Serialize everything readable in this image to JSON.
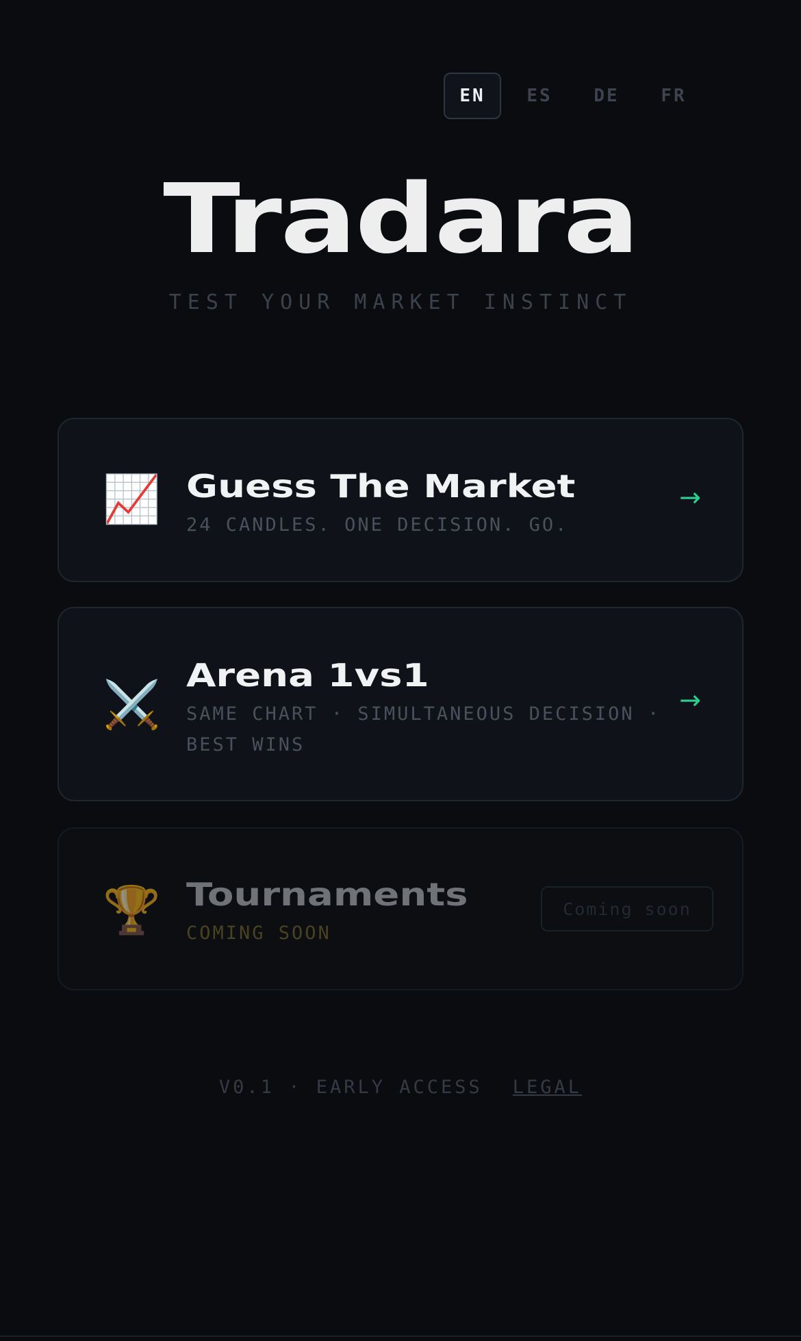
{
  "languages": [
    {
      "code": "EN",
      "active": true
    },
    {
      "code": "ES",
      "active": false
    },
    {
      "code": "DE",
      "active": false
    },
    {
      "code": "FR",
      "active": false
    }
  ],
  "app": {
    "title": "Tradara",
    "subtitle": "TEST YOUR MARKET INSTINCT"
  },
  "modes": [
    {
      "icon": "📈",
      "icon_name": "chart-increasing-icon",
      "title": "Guess The Market",
      "description": "24 CANDLES. ONE DECISION. GO.",
      "arrow": "→"
    },
    {
      "icon": "⚔️",
      "icon_name": "crossed-swords-icon",
      "title": "Arena 1vs1",
      "description": "SAME CHART · SIMULTANEOUS DECISION · BEST WINS",
      "arrow": "→"
    },
    {
      "icon": "🏆",
      "icon_name": "trophy-icon",
      "title": "Tournaments",
      "description": "COMING SOON",
      "badge": "Coming soon"
    }
  ],
  "footer": {
    "version": "V0.1 · EARLY ACCESS",
    "legal": "LEGAL"
  },
  "colors": {
    "background": "#0a0c10",
    "accent": "#2bd08f",
    "card": "#0f1319",
    "muted": "#4a515c",
    "coming_soon": "#4a4220"
  }
}
